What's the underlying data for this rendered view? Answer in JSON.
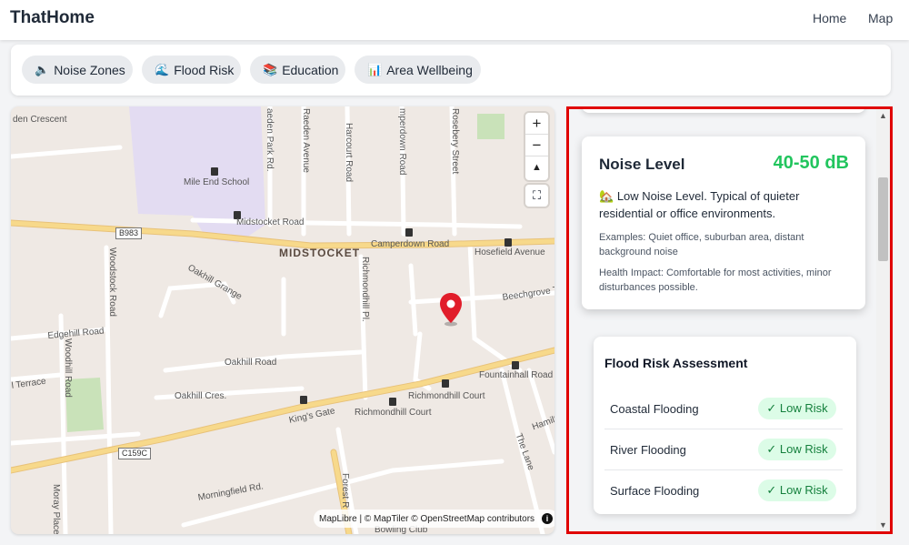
{
  "app": {
    "brand": "ThatHome"
  },
  "nav": {
    "home": "Home",
    "map": "Map"
  },
  "filters": [
    {
      "label": "Noise Zones",
      "icon": "🔈"
    },
    {
      "label": "Flood Risk",
      "icon": "🌊"
    },
    {
      "label": "Education",
      "icon": "📚"
    },
    {
      "label": "Area Wellbeing",
      "icon": "📊"
    }
  ],
  "map": {
    "labels": {
      "raeden_crescent": "den Crescent",
      "raeden_park": "aeden Park Rd.",
      "raeden_avenue": "Raeden Avenue",
      "harcourt": "Harcourt Road",
      "camperdown_v": "mperdown Road",
      "rosebery": "Rosebery Street",
      "mile_end_school": "Mile End School",
      "midstocket_road": "Midstocket Road",
      "midstocket": "MIDSTOCKET",
      "camperdown_road": "Camperdown Road",
      "hosefield": "Hosefield Avenue",
      "woodstock": "Woodstock Road",
      "oakhill_grange": "Oakhill Grange",
      "richmondhill_pl": "Richmondhill Pl.",
      "beechgrove": "Beechgrove T",
      "edgehill": "Edgehill Road",
      "woodhill": "Woodhill Road",
      "oakhill_road": "Oakhill Road",
      "terrace": "l Terrace",
      "oakhill_cres": "Oakhill Cres.",
      "richmondhill_ct1": "Richmondhill Court",
      "richmondhill_ct2": "Richmondhill Court",
      "fountainhall": "Fountainhall Road",
      "kings_gate": "King's Gate",
      "hamilton": "Hamilt",
      "the_lane": "The Lane",
      "forest": "Forest R",
      "morningfield": "Morningfield Rd.",
      "moray": "Moray Place",
      "bowling": "Bowling Club"
    },
    "shields": {
      "b983": "B983",
      "c159c": "C159C"
    },
    "zoom": {
      "in": "+",
      "out": "−",
      "compass": "▲"
    },
    "fullscreen_icon": "⛶",
    "attribution": "MapLibre | © MapTiler © OpenStreetMap contributors",
    "info_glyph": "i",
    "colors": {
      "land": "#efe9e4",
      "major_road": "#f7d98b",
      "school": "#e3dcf2",
      "park": "#c9e2b9",
      "pin": "#e11d2a"
    }
  },
  "panel": {
    "scroll_up": "▲",
    "scroll_down": "▼",
    "noise": {
      "title": "Noise Level",
      "value": "40-50 dB",
      "icon": "🏡",
      "description": "Low Noise Level. Typical of quieter residential or office environments.",
      "examples": "Examples: Quiet office, suburban area, distant background noise",
      "health": "Health Impact: Comfortable for most activities, minor disturbances possible."
    },
    "flood": {
      "title": "Flood Risk Assessment",
      "rows": [
        {
          "label": "Coastal Flooding",
          "risk": "✓ Low Risk"
        },
        {
          "label": "River Flooding",
          "risk": "✓ Low Risk"
        },
        {
          "label": "Surface Flooding",
          "risk": "✓ Low Risk"
        }
      ]
    }
  }
}
